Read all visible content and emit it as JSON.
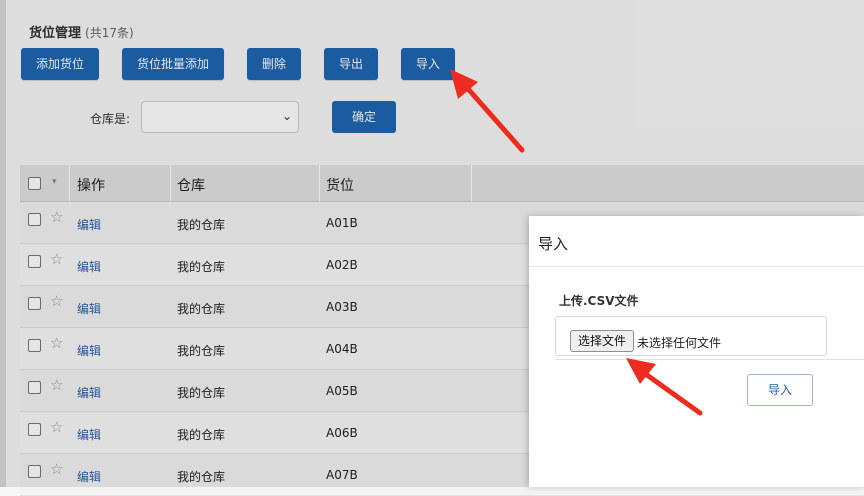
{
  "header": {
    "title": "货位管理",
    "count": "(共17条)"
  },
  "toolbar": {
    "add": "添加货位",
    "batch_add": "货位批量添加",
    "delete": "删除",
    "export": "导出",
    "import": "导入"
  },
  "filter": {
    "label": "仓库是:",
    "select_value": "",
    "confirm": "确定"
  },
  "table": {
    "headers": [
      "操作",
      "仓库",
      "货位"
    ],
    "rows": [
      {
        "action": "编辑",
        "warehouse": "我的仓库",
        "location": "A01B"
      },
      {
        "action": "编辑",
        "warehouse": "我的仓库",
        "location": "A02B"
      },
      {
        "action": "编辑",
        "warehouse": "我的仓库",
        "location": "A03B"
      },
      {
        "action": "编辑",
        "warehouse": "我的仓库",
        "location": "A04B"
      },
      {
        "action": "编辑",
        "warehouse": "我的仓库",
        "location": "A05B"
      },
      {
        "action": "编辑",
        "warehouse": "我的仓库",
        "location": "A06B"
      },
      {
        "action": "编辑",
        "warehouse": "我的仓库",
        "location": "A07B"
      }
    ]
  },
  "modal": {
    "title": "导入",
    "upload_label": "上传.CSV文件",
    "choose_file": "选择文件",
    "no_file": "未选择任何文件",
    "submit": "导入"
  },
  "colors": {
    "primary": "#1f66b3",
    "link": "#2a5ea8",
    "arrow": "#ee2b1f"
  }
}
